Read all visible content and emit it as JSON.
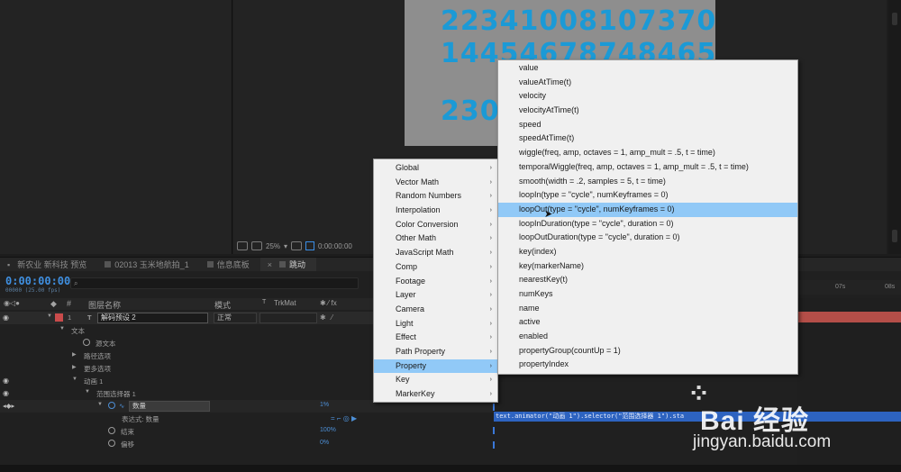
{
  "canvas": {
    "line1": "223410081073707",
    "line2": "144546787484​65",
    "line3": "230"
  },
  "viewer": {
    "zoom": "25%",
    "timecode": "0:00:00:00"
  },
  "tabs": [
    {
      "label": "新农业 新科技 预览",
      "active": false
    },
    {
      "label": "02013 玉米地航拍_1",
      "active": false
    },
    {
      "label": "信息底板",
      "active": false
    },
    {
      "label": "跳动",
      "active": true
    }
  ],
  "timeline": {
    "timecode": "0:00:00:00",
    "timecode_sub": "00000 (25.00 fps)",
    "search_placeholder": "",
    "columns": {
      "hash": "#",
      "layer_name": "图层名称",
      "mode": "模式",
      "t": "T",
      "trkmat": "TrkMat"
    },
    "layer": {
      "index": "1",
      "type_icon": "T",
      "name": "解码预设 2",
      "mode": "正常"
    },
    "rows": {
      "text": "文本",
      "source_text": "源文本",
      "path_options": "路径选项",
      "more_options": "更多选项",
      "animator": "动画 1",
      "selector": "范围选择器 1",
      "amount": "数量",
      "expression_label": "表达式: 数量",
      "end": "结束",
      "offset": "偏移"
    },
    "values": {
      "amount": "1%",
      "end": "100%",
      "offset": "0%"
    },
    "ruler": {
      "mark1": "07s",
      "mark2": "08s"
    },
    "expression": "text.animator(\"动画 1\").selector(\"范围选择器 1\").sta"
  },
  "menus": {
    "categories": [
      {
        "label": "Global",
        "highlighted": false
      },
      {
        "label": "Vector Math",
        "highlighted": false
      },
      {
        "label": "Random Numbers",
        "highlighted": false
      },
      {
        "label": "Interpolation",
        "highlighted": false
      },
      {
        "label": "Color Conversion",
        "highlighted": false
      },
      {
        "label": "Other Math",
        "highlighted": false
      },
      {
        "label": "JavaScript Math",
        "highlighted": false
      },
      {
        "label": "Comp",
        "highlighted": false
      },
      {
        "label": "Footage",
        "highlighted": false
      },
      {
        "label": "Layer",
        "highlighted": false
      },
      {
        "label": "Camera",
        "highlighted": false
      },
      {
        "label": "Light",
        "highlighted": false
      },
      {
        "label": "Effect",
        "highlighted": false
      },
      {
        "label": "Path Property",
        "highlighted": false
      },
      {
        "label": "Property",
        "highlighted": true
      },
      {
        "label": "Key",
        "highlighted": false
      },
      {
        "label": "MarkerKey",
        "highlighted": false
      }
    ],
    "property": [
      {
        "label": "value",
        "highlighted": false
      },
      {
        "label": "valueAtTime(t)",
        "highlighted": false
      },
      {
        "label": "velocity",
        "highlighted": false
      },
      {
        "label": "velocityAtTime(t)",
        "highlighted": false
      },
      {
        "label": "speed",
        "highlighted": false
      },
      {
        "label": "speedAtTime(t)",
        "highlighted": false
      },
      {
        "label": "wiggle(freq, amp, octaves = 1, amp_mult = .5, t = time)",
        "highlighted": false
      },
      {
        "label": "temporalWiggle(freq, amp, octaves = 1, amp_mult = .5, t = time)",
        "highlighted": false
      },
      {
        "label": "smooth(width = .2, samples = 5, t = time)",
        "highlighted": false
      },
      {
        "label": "loopIn(type = \"cycle\", numKeyframes = 0)",
        "highlighted": false
      },
      {
        "label": "loopOut(type = \"cycle\", numKeyframes = 0)",
        "highlighted": true
      },
      {
        "label": "loopInDuration(type = \"cycle\", duration = 0)",
        "highlighted": false
      },
      {
        "label": "loopOutDuration(type = \"cycle\", duration = 0)",
        "highlighted": false
      },
      {
        "label": "key(index)",
        "highlighted": false
      },
      {
        "label": "key(markerName)",
        "highlighted": false
      },
      {
        "label": "nearestKey(t)",
        "highlighted": false
      },
      {
        "label": "numKeys",
        "highlighted": false
      },
      {
        "label": "name",
        "highlighted": false
      },
      {
        "label": "active",
        "highlighted": false
      },
      {
        "label": "enabled",
        "highlighted": false
      },
      {
        "label": "propertyGroup(countUp = 1)",
        "highlighted": false
      },
      {
        "label": "propertyIndex",
        "highlighted": false
      }
    ]
  },
  "watermark": {
    "brand": "Bai 经验",
    "url": "jingyan.baidu.com"
  },
  "colors": {
    "accent_blue": "#3f8fe0",
    "menu_highlight": "#91c9f7",
    "layer_label": "#c94b4b",
    "digits": "#1b9ad6"
  }
}
